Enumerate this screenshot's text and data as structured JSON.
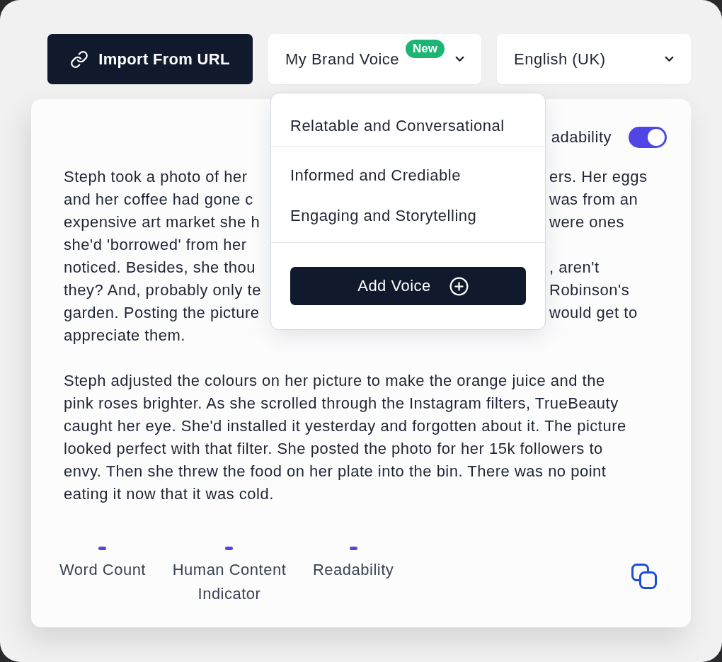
{
  "toolbar": {
    "import_button": {
      "label": "Import From URL"
    },
    "voice_select": {
      "value": "My Brand Voice",
      "badge": "New"
    },
    "language_select": {
      "value": "English (UK)"
    }
  },
  "editor": {
    "readability_toggle": {
      "label": "adability",
      "on": true
    },
    "paragraph_1_lines": [
      {
        "left": "Steph took a photo of her",
        "right": "ers. Her eggs"
      },
      {
        "left": "and her coffee had gone c",
        "right": "was from an"
      },
      {
        "left": "expensive art market she h",
        "right": "were ones"
      },
      {
        "left": "she'd 'borrowed' from her"
      },
      {
        "left": "noticed. Besides, she thou",
        "right": ", aren't"
      },
      {
        "left": "they? And, probably only te",
        "right": "Robinson's"
      },
      {
        "left": "garden. Posting the picture",
        "right": "would get to"
      },
      {
        "left": "appreciate them."
      }
    ],
    "paragraph_2": "Steph adjusted the colours on her picture to make the orange juice and the pink roses brighter. As she scrolled through the Instagram filters, TrueBeauty caught her eye. She'd installed it yesterday and forgotten about it. The picture looked perfect with that filter. She posted the photo for her 15k followers to envy. Then she threw the food on her plate into the bin. There was no point eating it now that it was cold.",
    "metrics": [
      {
        "label": "Word Count"
      },
      {
        "label": "Human Content Indicator"
      },
      {
        "label": "Readability"
      }
    ]
  },
  "voice_menu": {
    "groups": [
      {
        "items": [
          "Relatable and Conversational"
        ]
      },
      {
        "items": [
          "Informed and Crediable",
          "Engaging and Storytelling"
        ]
      }
    ],
    "add_button": {
      "label": "Add Voice"
    }
  }
}
